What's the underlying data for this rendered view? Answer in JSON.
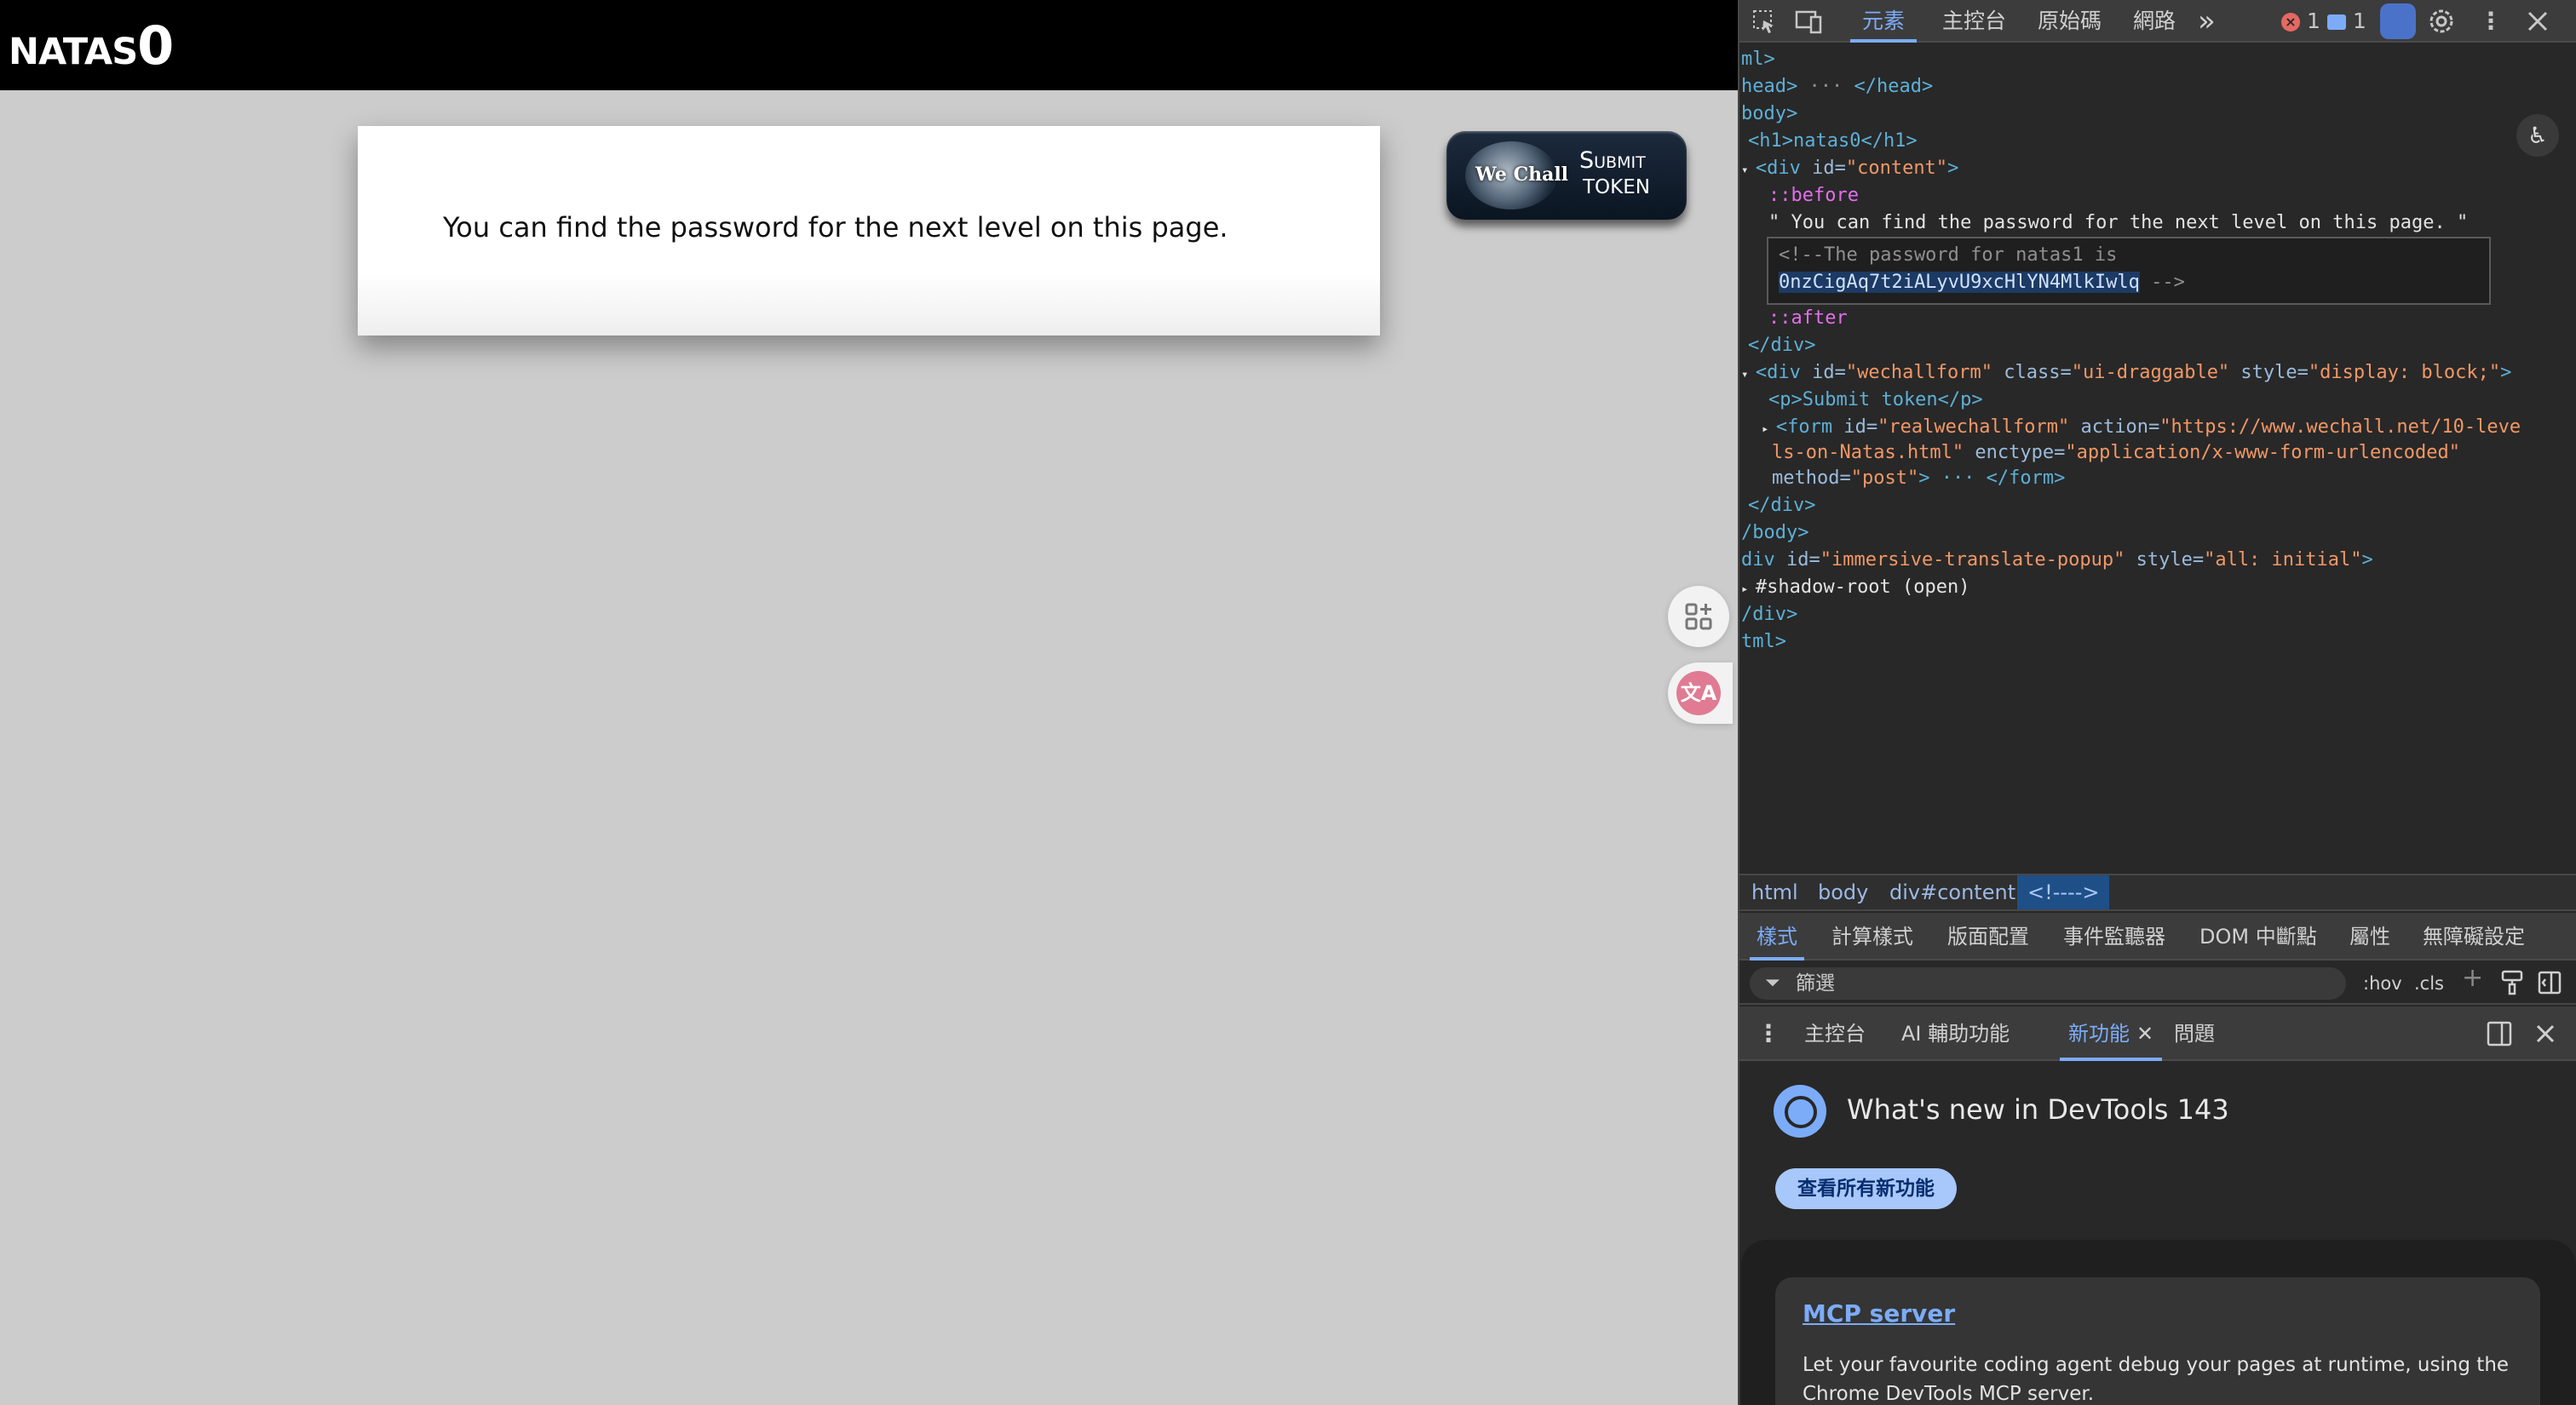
{
  "page": {
    "title": "natas0",
    "content_text": "You can find the password for the next level on this page.",
    "wechall": {
      "logo_text": "We Chall",
      "line1": "Submit",
      "line2": "TOKEN"
    },
    "translate_icon": "文A"
  },
  "devtools": {
    "toolbar": {
      "tabs": [
        "元素",
        "主控台",
        "原始碼",
        "網路"
      ],
      "more": "»",
      "errors": "1",
      "messages": "1"
    },
    "tree": {
      "l1": "ml>",
      "l2_a": "head>",
      "l2_b": "</head>",
      "l3": "body>",
      "l4": "<h1>natas0</h1>",
      "l5_tag": "<div ",
      "l5_attr": "id=",
      "l5_val": "\"content\"",
      "l5_end": ">",
      "l6": "::before",
      "l7": "\" You can find the password for the next level on this page. \"",
      "l8": "<!--The password for natas1 is",
      "l9_sel": "0nzCigAq7t2iALyvU9xcHlYN4MlkIwlq",
      "l9_end": " -->",
      "l10": "::after",
      "l11": "</div>",
      "l12_tag": "<div ",
      "l12_a1": "id=",
      "l12_v1": "\"wechallform\"",
      "l12_a2": " class=",
      "l12_v2": "\"ui-draggable\"",
      "l12_a3": " style=",
      "l12_v3": "\"display: block;\"",
      "l12_end": ">",
      "l13": "<p>Submit token</p>",
      "l14_tag": "<form ",
      "l14_a1": "id=",
      "l14_v1": "\"realwechallform\"",
      "l14_a2": " action=",
      "l14_v2": "\"https://www.wechall.net/10-leve",
      "l15_v": "ls-on-Natas.html\"",
      "l15_a": " enctype=",
      "l15_v2": "\"application/x-www-form-urlencoded\"",
      "l16_a": "method=",
      "l16_v": "\"post\"",
      "l16_end": "> ··· </form>",
      "l17": "</div>",
      "l18": "/body>",
      "l19_tag": "div ",
      "l19_a1": "id=",
      "l19_v1": "\"immersive-translate-popup\"",
      "l19_a2": " style=",
      "l19_v2": "\"all: initial\"",
      "l19_end": ">",
      "l20": "#shadow-root (open)",
      "l21": "/div>",
      "l22": "tml>"
    },
    "breadcrumbs": [
      "html",
      "body",
      "div#content",
      "<!---->"
    ],
    "styles_tabs": [
      "樣式",
      "計算樣式",
      "版面配置",
      "事件監聽器",
      "DOM 中斷點",
      "屬性",
      "無障礙設定"
    ],
    "filter": {
      "placeholder": "篩選",
      "hov": ":hov",
      "cls": ".cls",
      "plus": "+"
    },
    "drawer_tabs": [
      "主控台",
      "AI 輔助功能",
      "新功能",
      "問題"
    ],
    "whats_new": {
      "title": "What's new in DevTools 143",
      "button": "查看所有新功能",
      "card_title": "MCP server",
      "card_desc": "Let your favourite coding agent debug your pages at runtime, using the Chrome DevTools MCP server."
    }
  }
}
